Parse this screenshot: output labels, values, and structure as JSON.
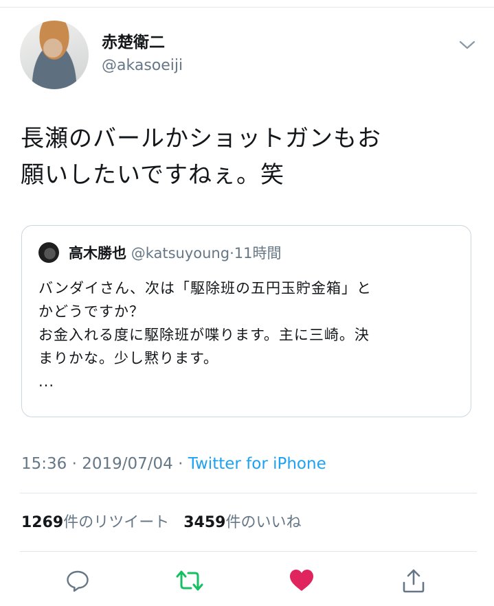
{
  "tweet": {
    "author": {
      "display_name": "赤楚衛二",
      "handle": "@akasoeiji"
    },
    "text_lines": [
      "長瀬のバールかショットガンもお",
      "願いしたいですねぇ。笑"
    ],
    "quoted": {
      "display_name": "高木勝也",
      "handle": "@katsuyoung",
      "separator": "·",
      "time": "11時間",
      "text_lines": [
        "バンダイさん、次は「駆除班の五円玉貯金箱」と",
        "かどうですか？",
        "お金入れる度に駆除班が喋ります。主に三崎。決",
        "まりかな。少し黙ります。",
        "..."
      ]
    },
    "timestamp": {
      "time": "15:36",
      "sep1": "·",
      "date": "2019/07/04",
      "sep2": "·",
      "via": "Twitter for iPhone"
    },
    "stats": {
      "retweets_count": "1269",
      "retweets_label": "件のリツイート",
      "likes_count": "3459",
      "likes_label": "件のいいね"
    }
  },
  "icons": {
    "menu": "chevron-down-icon",
    "reply": "reply-icon",
    "retweet": "retweet-icon",
    "like": "heart-icon",
    "share": "share-icon"
  },
  "colors": {
    "text": "#14171a",
    "secondary": "#657786",
    "link": "#1da1f2",
    "retweet": "#17bf63",
    "like": "#e0245e",
    "border": "#ccd6dd"
  }
}
